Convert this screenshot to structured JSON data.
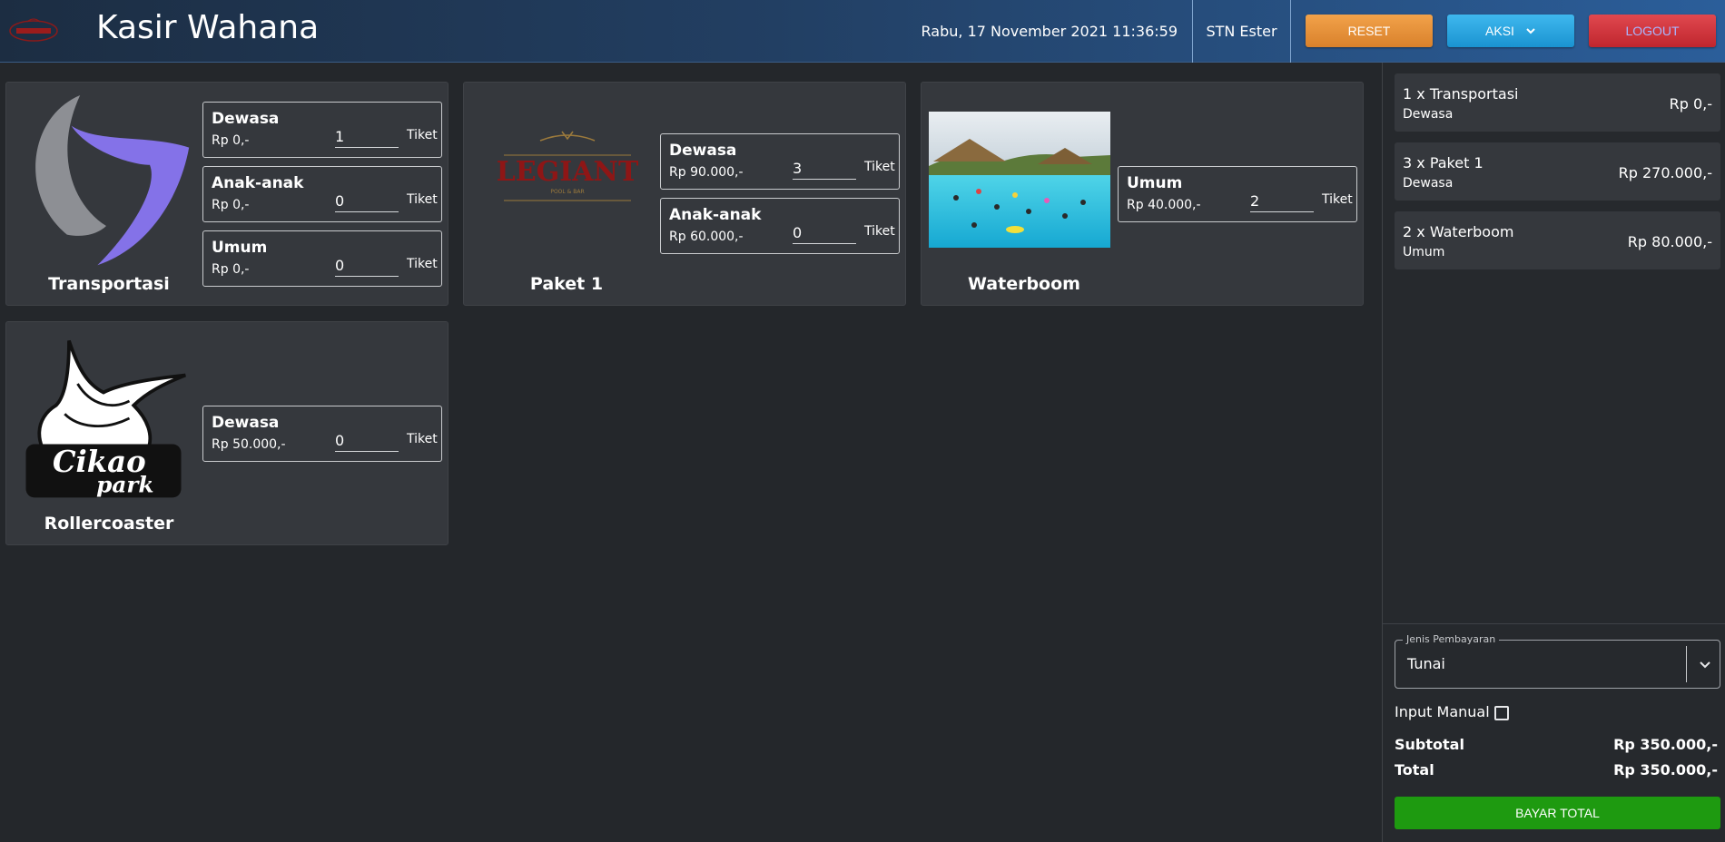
{
  "header": {
    "title": "Kasir Wahana",
    "datetime": "Rabu, 17 November 2021 11:36:59",
    "user": "STN Ester",
    "buttons": {
      "reset": "RESET",
      "aksi": "AKSI",
      "logout": "LOGOUT"
    }
  },
  "colors": {
    "accent_blue": "#2b5e9a",
    "reset": "#e8922f",
    "aksi": "#2aa6e0",
    "logout": "#d23339",
    "pay": "#1e9a10",
    "card": "#35383d",
    "background": "#24272b"
  },
  "rides": [
    {
      "name": "Transportasi",
      "icon": "transportasi-logo",
      "tickets": [
        {
          "category": "Dewasa",
          "price": "Rp 0,-",
          "qty": "1",
          "unit": "Tiket"
        },
        {
          "category": "Anak-anak",
          "price": "Rp 0,-",
          "qty": "0",
          "unit": "Tiket"
        },
        {
          "category": "Umum",
          "price": "Rp 0,-",
          "qty": "0",
          "unit": "Tiket"
        }
      ]
    },
    {
      "name": "Paket 1",
      "icon": "legiant-logo",
      "logo_text": "LEGIANT",
      "logo_subtext": "POOL & BAR",
      "tickets": [
        {
          "category": "Dewasa",
          "price": "Rp 90.000,-",
          "qty": "3",
          "unit": "Tiket"
        },
        {
          "category": "Anak-anak",
          "price": "Rp 60.000,-",
          "qty": "0",
          "unit": "Tiket"
        }
      ]
    },
    {
      "name": "Waterboom",
      "icon": "waterboom-photo",
      "tickets": [
        {
          "category": "Umum",
          "price": "Rp 40.000,-",
          "qty": "2",
          "unit": "Tiket"
        }
      ]
    },
    {
      "name": "Rollercoaster",
      "icon": "cikao-park-logo",
      "logo_text_1": "Cikao",
      "logo_text_2": "park",
      "tickets": [
        {
          "category": "Dewasa",
          "price": "Rp 50.000,-",
          "qty": "0",
          "unit": "Tiket"
        }
      ]
    }
  ],
  "order": {
    "items": [
      {
        "name": "1 x Transportasi",
        "category": "Dewasa",
        "price": "Rp 0,-"
      },
      {
        "name": "3 x Paket 1",
        "category": "Dewasa",
        "price": "Rp 270.000,-"
      },
      {
        "name": "2 x Waterboom",
        "category": "Umum",
        "price": "Rp 80.000,-"
      }
    ],
    "payment_label": "Jenis Pembayaran",
    "payment_value": "Tunai",
    "manual_label": "Input Manual",
    "subtotal_label": "Subtotal",
    "subtotal_value": "Rp 350.000,-",
    "total_label": "Total",
    "total_value": "Rp 350.000,-",
    "pay_button": "BAYAR TOTAL"
  }
}
